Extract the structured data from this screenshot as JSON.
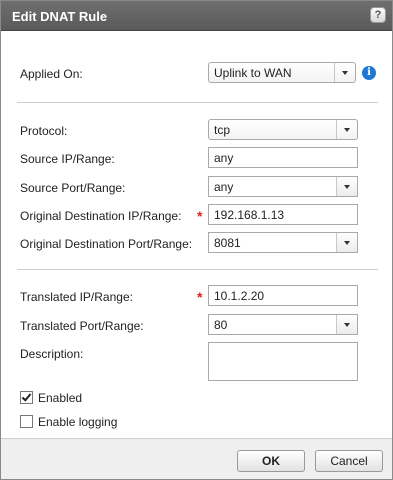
{
  "window": {
    "title": "Edit DNAT Rule",
    "help_label": "?"
  },
  "applied_on": {
    "label": "Applied On:",
    "value": "Uplink to WAN",
    "info_glyph": "i"
  },
  "rule": {
    "protocol_label": "Protocol:",
    "protocol_value": "tcp",
    "source_ip_label": "Source IP/Range:",
    "source_ip_value": "any",
    "source_port_label": "Source Port/Range:",
    "source_port_value": "any",
    "orig_dest_ip_label": "Original Destination IP/Range:",
    "orig_dest_ip_value": "192.168.1.13",
    "orig_dest_port_label": "Original Destination Port/Range:",
    "orig_dest_port_value": "8081"
  },
  "translation": {
    "translated_ip_label": "Translated IP/Range:",
    "translated_ip_value": "10.1.2.20",
    "translated_port_label": "Translated Port/Range:",
    "translated_port_value": "80",
    "description_label": "Description:",
    "description_value": ""
  },
  "options": {
    "enabled_label": "Enabled",
    "enabled_checked": true,
    "logging_label": "Enable logging",
    "logging_checked": false
  },
  "required_marker": "*",
  "footer": {
    "ok_label": "OK",
    "cancel_label": "Cancel"
  }
}
